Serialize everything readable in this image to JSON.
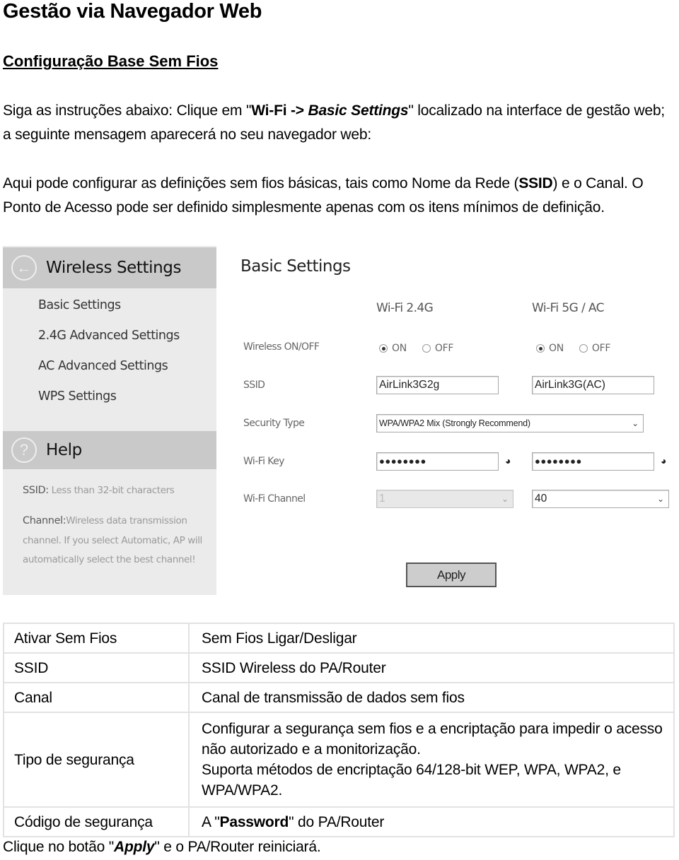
{
  "document": {
    "title": "Gestão via Navegador Web",
    "subtitle": "Configuração Base Sem Fios",
    "intro": {
      "part1": "Siga as instruções abaixo: Clique em \"",
      "bold": "Wi-Fi -> ",
      "bold_italic": "Basic Settings",
      "part2": "\" localizado na interface de gestão web; a seguinte mensagem aparecerá no seu navegador web:"
    },
    "description": {
      "part1": "Aqui pode configurar as definições sem fios básicas, tais como Nome da Rede (",
      "bold": "SSID",
      "part2": ") e o Canal. O Ponto de Acesso pode ser definido simplesmente apenas com os itens mínimos de definição."
    },
    "closing": {
      "part1": "Clique no botão \"",
      "bold_italic": "Apply",
      "part2": "\" e o PA/Router reiniciará."
    }
  },
  "screenshot": {
    "sidebar": {
      "header": "Wireless Settings",
      "back_icon": "arrow-left-circle-icon",
      "items": [
        {
          "label": "Basic Settings"
        },
        {
          "label": "2.4G Advanced Settings"
        },
        {
          "label": "AC Advanced Settings"
        },
        {
          "label": "WPS Settings"
        }
      ],
      "help": {
        "header": "Help",
        "icon": "question-circle-icon",
        "ssid_label": "SSID:",
        "ssid_text": " Less than 32-bit characters",
        "channel_label": "Channel:",
        "channel_text": "Wireless data transmission channel. If you select Automatic, AP will automatically select the best channel!"
      }
    },
    "main": {
      "title": "Basic Settings",
      "columns": [
        "Wi-Fi 2.4G",
        "Wi-Fi 5G / AC"
      ],
      "labels": {
        "wireless": "Wireless ON/OFF",
        "ssid": "SSID",
        "security": "Security Type",
        "key": "Wi-Fi Key",
        "channel": "Wi-Fi Channel"
      },
      "radio": {
        "on": "ON",
        "off": "OFF",
        "band24_selected": "ON",
        "band5_selected": "ON"
      },
      "ssid_24": "AirLink3G2g",
      "ssid_5": "AirLink3G(AC)",
      "security_type": "WPA/WPA2 Mix (Strongly Recommend)",
      "key_24": "●●●●●●●●",
      "key_5": "●●●●●●●●",
      "channel_24": "1",
      "channel_5": "40",
      "apply": "Apply"
    }
  },
  "table": {
    "rows": [
      {
        "key": "Ativar Sem Fios",
        "value": "Sem Fios Ligar/Desligar"
      },
      {
        "key": "SSID",
        "value": "SSID Wireless do PA/Router"
      },
      {
        "key": "Canal",
        "value": "Canal de transmissão de dados sem fios"
      },
      {
        "key": "Tipo de segurança",
        "value_line1": "Configurar a segurança sem fios e a encriptação para impedir o acesso não autorizado e a monitorização.",
        "value_line2": "Suporta métodos de encriptação 64/128-bit WEP, WPA, WPA2, e WPA/WPA2."
      },
      {
        "key": "Código de segurança",
        "value_part1": "A \"",
        "value_bold": "Password",
        "value_part2": "\" do PA/Router"
      }
    ]
  }
}
